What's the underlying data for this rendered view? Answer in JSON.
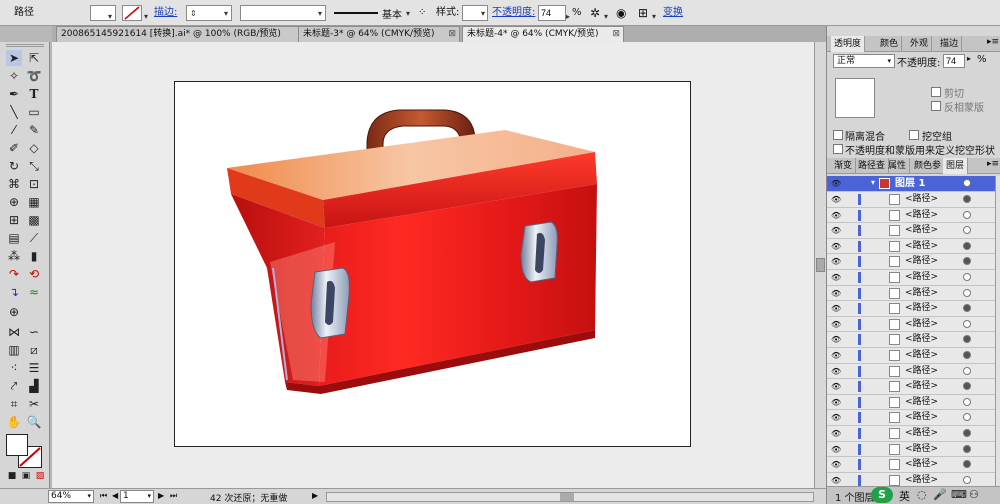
{
  "control_bar": {
    "object_type": "路径",
    "stroke_label": "描边:",
    "stroke_profile": "基本",
    "style_label": "样式:",
    "opacity_label": "不透明度:",
    "opacity_value": "74",
    "opacity_unit": "%",
    "transform_label": "变换"
  },
  "doc_tabs": [
    {
      "title": "200865145921614 [转换].ai* @ 100% (RGB/预览)",
      "close": "⊠"
    },
    {
      "title": "未标题-3* @ 64% (CMYK/预览)",
      "close": "⊠"
    },
    {
      "title": "未标题-4* @ 64% (CMYK/预览)",
      "close": "⊠"
    }
  ],
  "status_bar": {
    "zoom": "64%",
    "page": "1",
    "undo_text": "42 次还原；无重做"
  },
  "transparency_panel": {
    "tabs": [
      "透明度",
      "颜色",
      "外观",
      "描边"
    ],
    "blend_mode": "正常",
    "opacity_label": "不透明度:",
    "opacity_value": "74",
    "opacity_unit": "%",
    "clip_label": "剪切",
    "invert_mask_label": "反相蒙版",
    "isolate_blending_label": "隔离混合",
    "knockout_group_label": "挖空组",
    "opacity_mask_label": "不透明度和蒙版用来定义挖空形状"
  },
  "layers_panel": {
    "tabs": [
      "渐变",
      "路径查",
      "属性",
      "颜色参",
      "图层"
    ],
    "layer_name": "图层 1",
    "item_label": "<路径>",
    "footer": "1 个图层",
    "rows": [
      {
        "name": "<路径>",
        "filled": true
      },
      {
        "name": "<路径>",
        "filled": false
      },
      {
        "name": "<路径>",
        "filled": false
      },
      {
        "name": "<路径>",
        "filled": true
      },
      {
        "name": "<路径>",
        "filled": true
      },
      {
        "name": "<路径>",
        "filled": false
      },
      {
        "name": "<路径>",
        "filled": false
      },
      {
        "name": "<路径>",
        "filled": true
      },
      {
        "name": "<路径>",
        "filled": false
      },
      {
        "name": "<路径>",
        "filled": true
      },
      {
        "name": "<路径>",
        "filled": true
      },
      {
        "name": "<路径>",
        "filled": false
      },
      {
        "name": "<路径>",
        "filled": true
      },
      {
        "name": "<路径>",
        "filled": false
      },
      {
        "name": "<路径>",
        "filled": false
      },
      {
        "name": "<路径>",
        "filled": true
      },
      {
        "name": "<路径>",
        "filled": true
      },
      {
        "name": "<路径>",
        "filled": true
      },
      {
        "name": "<路径>",
        "filled": false
      }
    ]
  },
  "ime": {
    "label": "英"
  }
}
